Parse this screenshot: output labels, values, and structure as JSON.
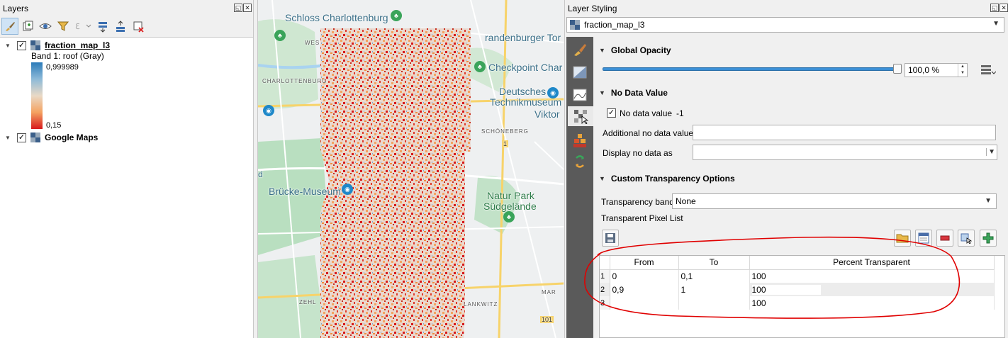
{
  "layers_panel": {
    "title": "Layers",
    "layers": [
      {
        "name": "fraction_map_l3",
        "checked": true,
        "band_label": "Band 1: roof (Gray)",
        "ramp_max": "0,999989",
        "ramp_min": "0,15"
      },
      {
        "name": "Google Maps",
        "checked": true
      }
    ],
    "toolbar_icons": [
      "paintbrush-icon",
      "add-group-icon",
      "eye-icon",
      "filter-icon",
      "expression-filter-icon",
      "expand-all-icon",
      "collapse-all-icon",
      "remove-layer-icon"
    ]
  },
  "map": {
    "labels": {
      "schloss": "Schloss Charlottenburg",
      "brandenburger": "randenburger Tor",
      "checkpoint": "Checkpoint Char",
      "deutsches1": "Deutsches",
      "deutsches2": "Technikmuseum",
      "viktor": "Viktor",
      "schoneberg": "SCHÖNEBERG",
      "charlottenburg": "CHARLOTTENBURG",
      "bruecke": "Brücke-Museum",
      "natur1": "Natur Park",
      "natur2": "Südgelände",
      "west": "WES",
      "mar": "MAR",
      "zehl": "ZEHL",
      "lankwitz": "LANKWITZ",
      "d_left": "d",
      "road_1": "1",
      "road_101": "101"
    }
  },
  "styling": {
    "title": "Layer Styling",
    "layer_combo": "fraction_map_l3",
    "global_opacity": {
      "title": "Global Opacity",
      "value": "100,0 %",
      "fraction": 1.0
    },
    "no_data": {
      "title": "No Data Value",
      "checkbox_label": "No data value",
      "checked": true,
      "value": "-1",
      "additional_label": "Additional no data value",
      "additional_value": "",
      "display_label": "Display no data as"
    },
    "transparency": {
      "title": "Custom Transparency Options",
      "band_label": "Transparency band",
      "band_value": "None",
      "list_label": "Transparent Pixel List",
      "columns": [
        "From",
        "To",
        "Percent Transparent"
      ],
      "rows": [
        {
          "n": "1",
          "from": "0",
          "to": "0,1",
          "percent": "100"
        },
        {
          "n": "2",
          "from": "0,9",
          "to": "1",
          "percent": "100"
        },
        {
          "n": "3",
          "from": "",
          "to": "",
          "percent": "100"
        }
      ]
    },
    "colors": {
      "accent": "#3a8fd6",
      "annotation": "#e00000",
      "sidebar": "#5a5a5a"
    }
  }
}
